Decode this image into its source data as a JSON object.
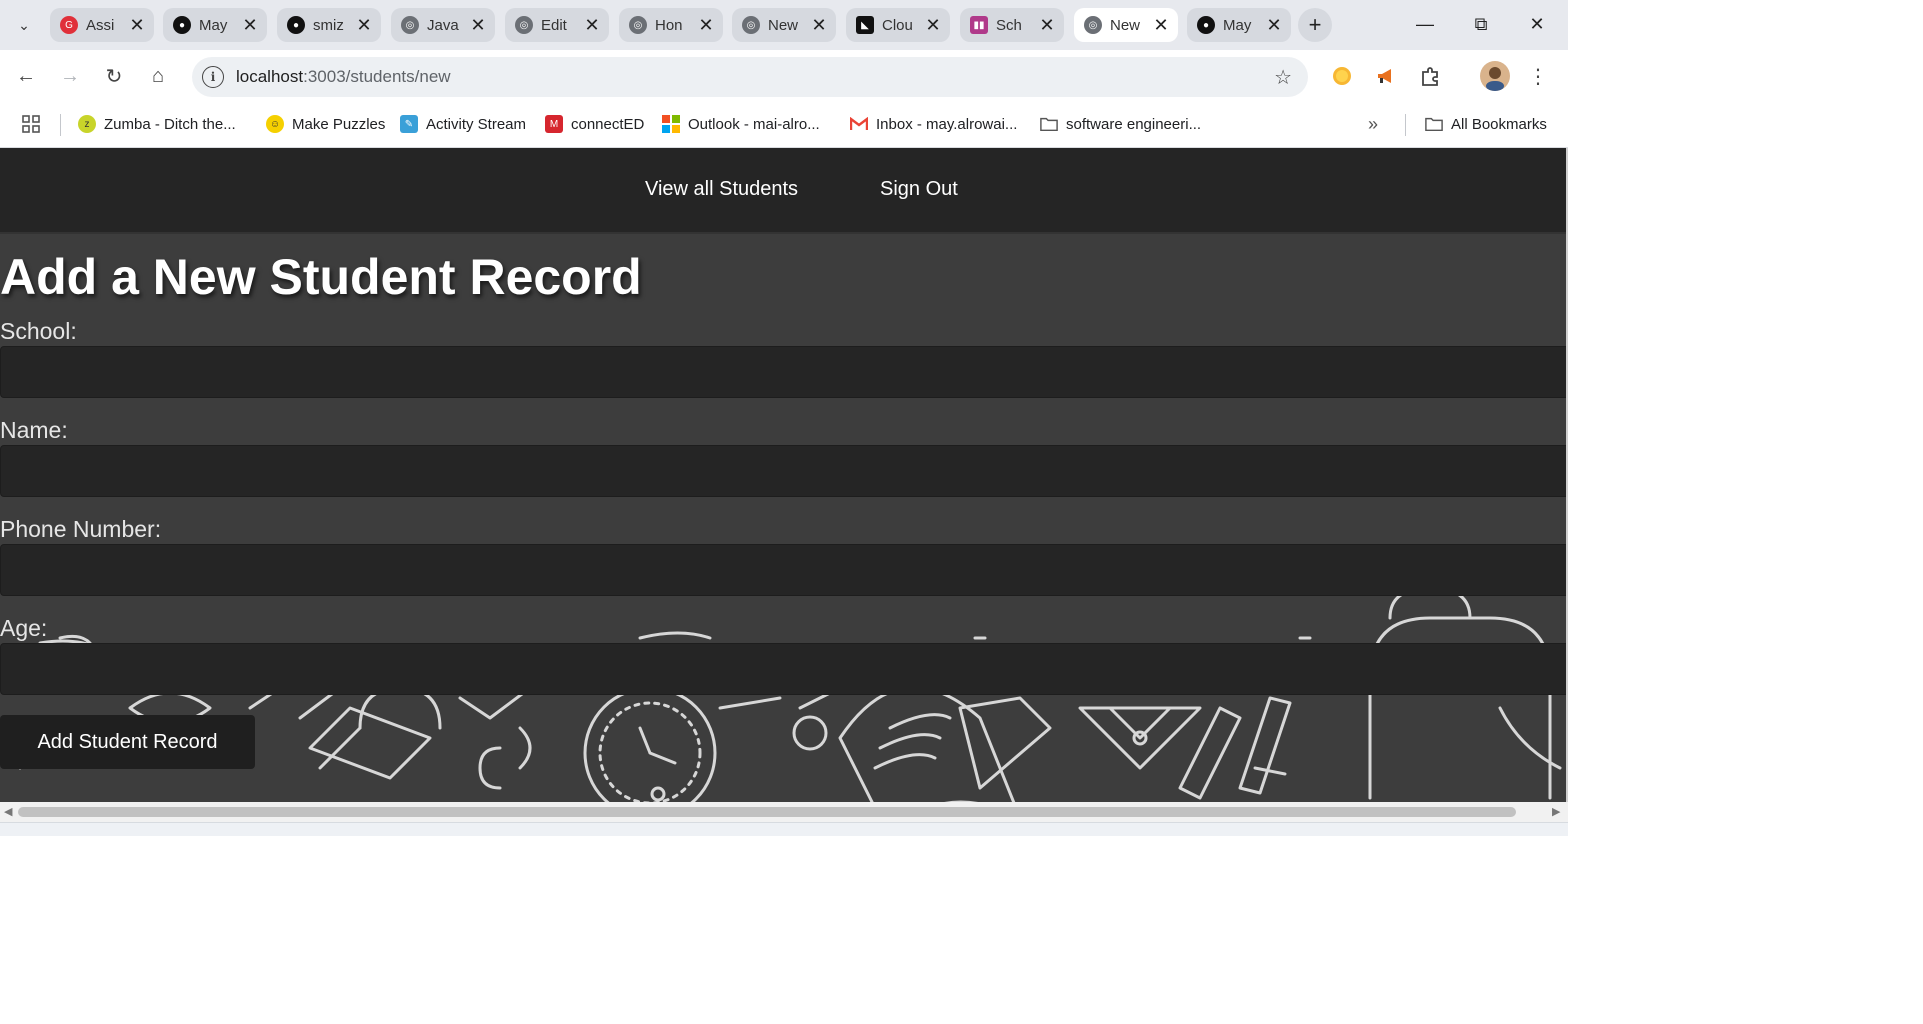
{
  "browser": {
    "tabs": [
      {
        "title": "Assi",
        "favicon": "red-circle-icon",
        "color": "#e0303a"
      },
      {
        "title": "May",
        "favicon": "github-icon",
        "color": "#111111"
      },
      {
        "title": "smiz",
        "favicon": "github-icon",
        "color": "#111111"
      },
      {
        "title": "Java",
        "favicon": "globe-icon",
        "color": "#5f6368"
      },
      {
        "title": "Edit",
        "favicon": "globe-icon",
        "color": "#5f6368"
      },
      {
        "title": "Hon",
        "favicon": "globe-icon",
        "color": "#5f6368"
      },
      {
        "title": "New",
        "favicon": "chrome-icon",
        "color": "#5f6368"
      },
      {
        "title": "Clou",
        "favicon": "cloud-icon",
        "color": "#111111"
      },
      {
        "title": "Sch",
        "favicon": "trello-icon",
        "color": "#b03a8a"
      },
      {
        "title": "New",
        "favicon": "globe-icon",
        "color": "#5f6368",
        "active": true
      },
      {
        "title": "May",
        "favicon": "github-icon",
        "color": "#111111"
      }
    ],
    "url": {
      "host": "localhost",
      "rest": ":3003/students/new"
    },
    "bookmarks": [
      {
        "label": "Zumba - Ditch the...",
        "icon": "zumba-icon",
        "color": "#c8d42a"
      },
      {
        "label": "Make Puzzles",
        "icon": "smiley-icon",
        "color": "#f5d000"
      },
      {
        "label": "Activity Stream",
        "icon": "pencil-icon",
        "color": "#3aa0d8"
      },
      {
        "label": "connectED",
        "icon": "mcgraw-hill-icon",
        "color": "#d6262e"
      },
      {
        "label": "Outlook - mai-alro...",
        "icon": "microsoft-icon",
        "color": "#f25022"
      },
      {
        "label": "Inbox - may.alrowai...",
        "icon": "gmail-icon",
        "color": "#ea4335"
      },
      {
        "label": "software engineeri...",
        "icon": "folder-icon",
        "color": "#5f6368"
      }
    ],
    "all_bookmarks_label": "All Bookmarks"
  },
  "nav": {
    "view_all": "View all Students",
    "sign_out": "Sign Out"
  },
  "form": {
    "title": "Add a New Student Record",
    "school_label": "School:",
    "name_label": "Name:",
    "phone_label": "Phone Number:",
    "age_label": "Age:",
    "school_value": "",
    "name_value": "",
    "phone_value": "",
    "age_value": "",
    "submit_label": "Add Student Record"
  }
}
